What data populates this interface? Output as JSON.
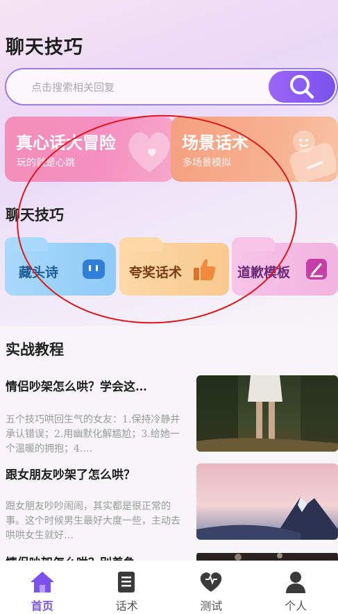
{
  "header": {
    "title": "聊天技巧"
  },
  "search": {
    "placeholder": "点击搜索相关回复",
    "icon": "search-icon"
  },
  "banners": [
    {
      "title": "真心话大冒险",
      "subtitle": "玩的就是心跳",
      "color": "#f48fb9"
    },
    {
      "title": "场景话术",
      "subtitle": "多场景模拟",
      "color": "#f5a080"
    }
  ],
  "tips_section": {
    "title": "聊天技巧",
    "items": [
      {
        "label": "藏头诗",
        "icon": "robot-icon",
        "color": "#8fcbf7"
      },
      {
        "label": "夸奖话术",
        "icon": "thumbs-up-icon",
        "color": "#f9c98f"
      },
      {
        "label": "道歉模板",
        "icon": "pencil-icon",
        "color": "#f2b3e0"
      }
    ]
  },
  "tutorial_section": {
    "title": "实战教程",
    "articles": [
      {
        "title": "情侣吵架怎么哄？学会这…",
        "desc": "五个技巧哄回生气的女友：1.保持冷静并承认错误；2.用幽默化解尴尬；3.给她一个温暖的拥抱；4.…"
      },
      {
        "title": "跟女朋友吵架了怎么哄？",
        "desc": "跟女朋友吵吵闹闹，其实都是很正常的事。这个时候男生最好大度一些，主动去哄哄女生就好…"
      },
      {
        "title": "情侣吵架怎么哄？别着急…",
        "desc": ""
      }
    ]
  },
  "tabbar": {
    "items": [
      {
        "label": "首页",
        "icon": "home-icon",
        "active": true
      },
      {
        "label": "话术",
        "icon": "document-icon",
        "active": false
      },
      {
        "label": "测试",
        "icon": "heart-icon",
        "active": false
      },
      {
        "label": "个人",
        "icon": "person-icon",
        "active": false
      }
    ]
  },
  "colors": {
    "accent": "#7b52ee",
    "annotation_ring": "#e0151a"
  }
}
